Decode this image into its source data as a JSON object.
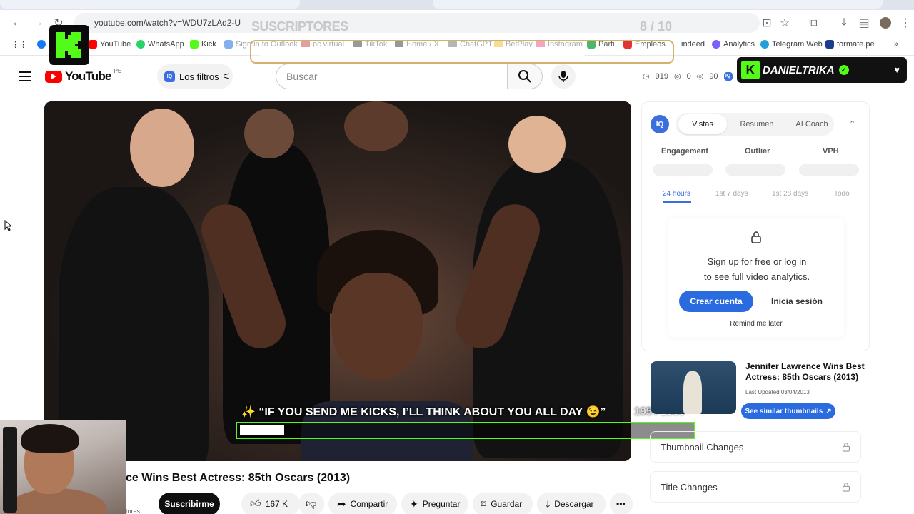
{
  "browser": {
    "url": "youtube.com/watch?v=WDU7zLAd2-U",
    "bookmarks": [
      "YouTube",
      "WhatsApp",
      "Kick",
      "Sign in to Outlook",
      "pc virtual",
      "TikTok",
      "Home / X",
      "ChatGPT",
      "BetPlay",
      "Instagram",
      "Parti",
      "Empleos",
      "indeed",
      "Analytics",
      "Telegram Web",
      "formate.pe"
    ]
  },
  "colors": {
    "youtube_red": "#ff0000",
    "kick_green": "#53fc18",
    "iq_blue": "#3b6fe0",
    "cta_blue": "#2a6be0"
  },
  "overlay": {
    "subs_label": "SUSCRIPTORES",
    "subs_count": "8 / 10",
    "subs_progress": 0.8,
    "streamer_name": "DANIELTRIKA",
    "kick_alert": "✨ “IF YOU SEND ME KICKS, I’LL THINK ABOUT YOU ALL DAY 😉”",
    "kick_goal_current": "195",
    "kick_goal_total": "/ 2000",
    "kick_progress": 0.0975
  },
  "youtube": {
    "logo_text": "YouTube",
    "country": "PE",
    "filters_label": "Los filtros",
    "search_placeholder": "Buscar",
    "stats": {
      "views": "919",
      "a": "0",
      "b": "90"
    },
    "video_title": "ce Wins Best Actress: 85th Oscars (2013)",
    "channel_sub": "tores",
    "subscribe": "Suscribirme",
    "likes": "167 K",
    "share": "Compartir",
    "ask": "Preguntar",
    "save": "Guardar",
    "download": "Descargar"
  },
  "panel": {
    "tabs": [
      "Vistas",
      "Resumen",
      "AI Coach"
    ],
    "metrics": [
      "Engagement",
      "Outlier",
      "VPH"
    ],
    "periods": [
      "24 hours",
      "1st 7 days",
      "1st 28 days",
      "Todo"
    ],
    "signup_line1_pre": "Sign up for ",
    "signup_free": "free",
    "signup_line1_post": " or log in",
    "signup_line2": "to see full video analytics.",
    "crear": "Crear cuenta",
    "inicia": "Inicia sesión",
    "remind": "Remind me later",
    "suggestion_title": "Jennifer Lawrence Wins Best Actress: 85th Oscars (2013)",
    "suggestion_updated": "Last Updated 03/04/2013",
    "similar_btn": "See similar thumbnails",
    "thumbnail_changes": "Thumbnail Changes",
    "title_changes": "Title Changes"
  }
}
